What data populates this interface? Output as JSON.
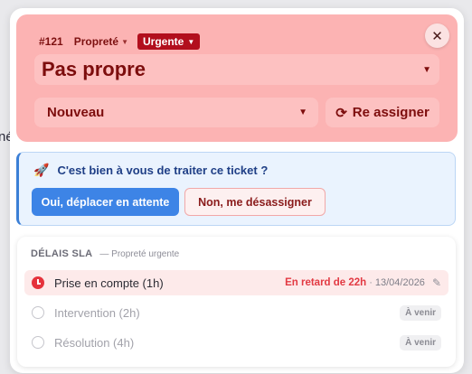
{
  "background": {
    "clipped_text": "né"
  },
  "header": {
    "ticket_number": "#121",
    "category": "Propreté",
    "priority": "Urgente",
    "title": "Pas propre",
    "status": "Nouveau",
    "reassign_label": "Re assigner",
    "colors": {
      "header_bg": "#fcb3b3",
      "priority_badge": "#b20f1d"
    }
  },
  "assignment_prompt": {
    "question": "C'est bien à vous de traiter ce ticket ?",
    "confirm_label": "Oui, déplacer en attente",
    "decline_label": "Non, me désassigner",
    "icon": "rocket-icon"
  },
  "sla": {
    "title": "DÉLAIS SLA",
    "subtitle": "— Propreté urgente",
    "rows": [
      {
        "label": "Prise en compte (1h)",
        "late_text": "En retard de 22h",
        "separator": "·",
        "date": "13/04/2026",
        "status": "late"
      },
      {
        "label": "Intervention (2h)",
        "badge": "À venir",
        "status": "upcoming"
      },
      {
        "label": "Résolution (4h)",
        "badge": "À venir",
        "status": "upcoming"
      }
    ]
  }
}
